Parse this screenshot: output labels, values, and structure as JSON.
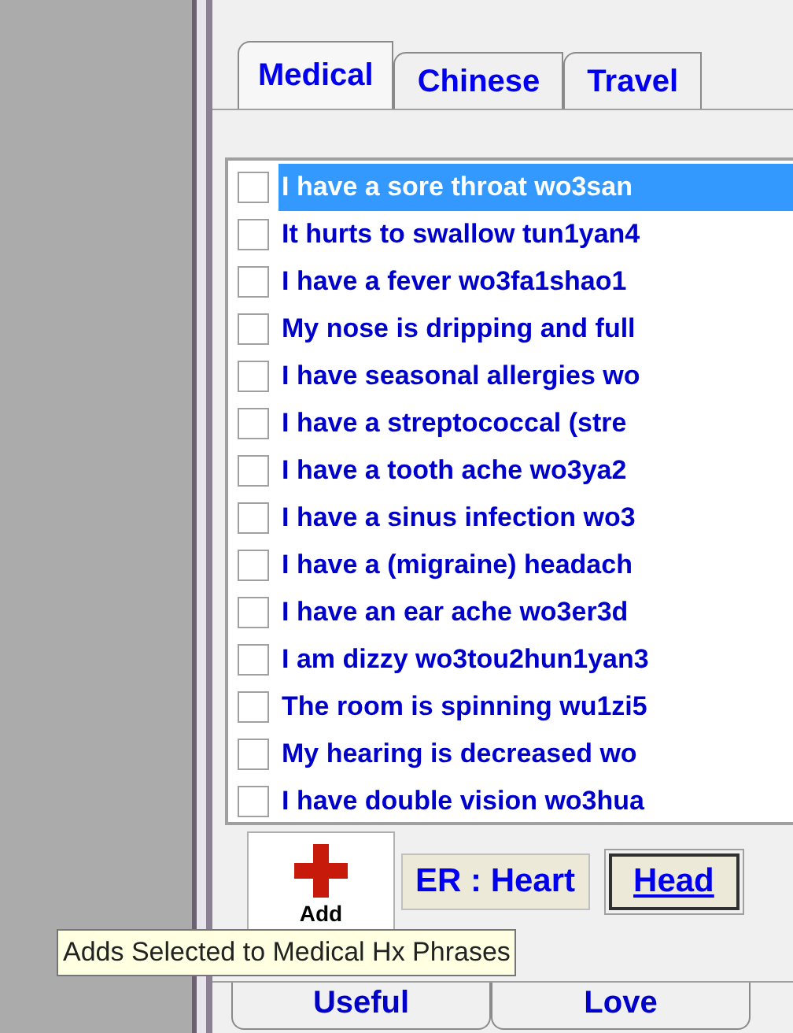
{
  "tabs": [
    {
      "label": "Medical",
      "selected": true
    },
    {
      "label": "Chinese",
      "selected": false
    },
    {
      "label": "Travel",
      "selected": false
    }
  ],
  "phrases": [
    {
      "text": "I have a sore throat wo3san",
      "checked": false,
      "selected": true
    },
    {
      "text": "It hurts to swallow tun1yan4",
      "checked": false,
      "selected": false
    },
    {
      "text": "I have a fever wo3fa1shao1",
      "checked": false,
      "selected": false
    },
    {
      "text": "My nose is dripping and full",
      "checked": false,
      "selected": false
    },
    {
      "text": "I have seasonal allergies wo",
      "checked": false,
      "selected": false
    },
    {
      "text": "I have a streptococcal (stre",
      "checked": false,
      "selected": false
    },
    {
      "text": "I have a tooth ache wo3ya2",
      "checked": false,
      "selected": false
    },
    {
      "text": "I have a sinus infection wo3",
      "checked": false,
      "selected": false
    },
    {
      "text": "I have a (migraine) headach",
      "checked": false,
      "selected": false
    },
    {
      "text": "I have an ear ache wo3er3d",
      "checked": false,
      "selected": false
    },
    {
      "text": "I am dizzy wo3tou2hun1yan3",
      "checked": false,
      "selected": false
    },
    {
      "text": "The room is spinning wu1zi5",
      "checked": false,
      "selected": false
    },
    {
      "text": "My hearing is decreased wo",
      "checked": false,
      "selected": false
    },
    {
      "text": "I have double vision wo3hua",
      "checked": false,
      "selected": false
    }
  ],
  "add_button": {
    "label": "Add"
  },
  "category_buttons": [
    {
      "label": "ER : Heart",
      "selected": false
    },
    {
      "label": "Head",
      "selected": true
    }
  ],
  "tooltip": "Adds Selected to Medical Hx Phrases",
  "bottom_tabs": [
    {
      "label": "Useful",
      "selected": false
    },
    {
      "label": "Love",
      "selected": false
    }
  ]
}
